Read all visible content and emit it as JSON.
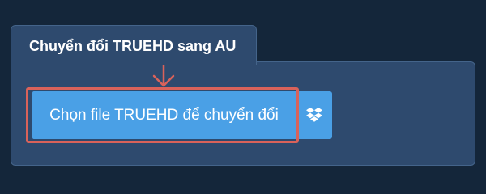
{
  "panel": {
    "title": "Chuyển đổi TRUEHD sang AU"
  },
  "upload": {
    "choose_file_label": "Chọn file TRUEHD để chuyển đổi",
    "dropbox_icon": "dropbox-icon",
    "arrow_icon": "arrow-down-icon"
  },
  "colors": {
    "page_background": "#14263a",
    "panel_background": "#2e4a6e",
    "button_blue": "#4aa0e6",
    "highlight_red": "#d9625a"
  }
}
